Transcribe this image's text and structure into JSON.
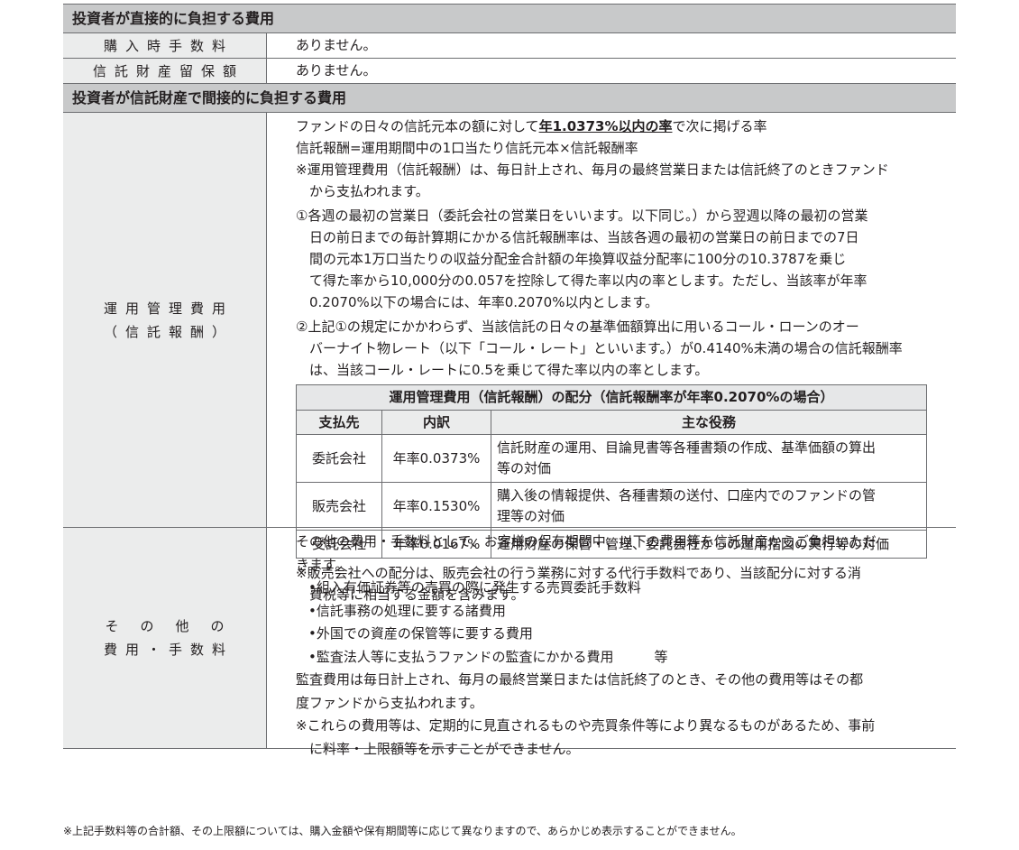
{
  "direct": {
    "header": "投資者が直接的に負担する費用",
    "rows": [
      {
        "label": "購入時手数料",
        "value": "ありません。"
      },
      {
        "label": "信託財産留保額",
        "value": "ありません。"
      }
    ]
  },
  "indirect": {
    "header": "投資者が信託財産で間接的に負担する費用",
    "mgmt": {
      "label_l1": "運用管理費用",
      "label_l2": "（信託報酬）",
      "p1_pre": "ファンドの日々の信託元本の額に対して",
      "p1_em": "年1.0373%以内の率",
      "p1_post": "で次に掲げる率",
      "p2": "信託報酬=運用期間中の1口当たり信託元本×信託報酬率",
      "n1_l1": "※運用管理費用（信託報酬）は、毎日計上され、毎月の最終営業日または信託終了のときファンド",
      "n1_l2": "から支払われます。",
      "c1_l1": "①各週の最初の営業日（委託会社の営業日をいいます。以下同じ。）から翌週以降の最初の営業",
      "c1_l2": "日の前日までの毎計算期にかかる信託報酬率は、当該各週の最初の営業日の前日までの7日",
      "c1_l3": "間の元本1万口当たりの収益分配金合計額の年換算収益分配率に100分の10.3787を乗じ",
      "c1_l4": "て得た率から10,000分の0.057を控除して得た率以内の率とします。ただし、当該率が年率",
      "c1_l5": "0.2070%以下の場合には、年率0.2070%以内とします。",
      "c2_l1": "②上記①の規定にかかわらず、当該信託の日々の基準価額算出に用いるコール・ローンのオー",
      "c2_l2": "バーナイト物レート（以下「コール・レート」といいます。）が0.4140%未満の場合の信託報酬率",
      "c2_l3": "は、当該コール・レートに0.5を乗じて得た率以内の率とします。",
      "table": {
        "title": "運用管理費用（信託報酬）の配分（信託報酬率が年率0.2070%の場合）",
        "headers": [
          "支払先",
          "内訳",
          "主な役務"
        ],
        "rows": [
          {
            "payee": "委託会社",
            "rate": "年率0.0373%",
            "role_l1": "信託財産の運用、目論見書等各種書類の作成、基準価額の算出",
            "role_l2": "等の対価"
          },
          {
            "payee": "販売会社",
            "rate": "年率0.1530%",
            "role_l1": "購入後の情報提供、各種書類の送付、口座内でのファンドの管",
            "role_l2": "理等の対価"
          },
          {
            "payee": "受託会社",
            "rate": "年率0.0167%",
            "role_l1": "運用財産の保管・管理、委託会社からの運用指図の実行等の対価",
            "role_l2": ""
          }
        ]
      },
      "n2_l1": "※販売会社への配分は、販売会社の行う業務に対する代行手数料であり、当該配分に対する消",
      "n2_l2": "費税等に相当する金額を含みます。"
    },
    "other": {
      "label_l1": "その他の",
      "label_l2": "費用・手数料",
      "p1_l1": "その他の費用・手数料として、お客様の保有期間中、以下の費用等を信託財産からご負担いただ",
      "p1_l2": "きます。",
      "bullets": [
        "•組入有価証券等の売買の際に発生する売買委託手数料",
        "•信託事務の処理に要する諸費用",
        "•外国での資産の保管等に要する費用",
        "•監査法人等に支払うファンドの監査にかかる費用　　　等"
      ],
      "p2_l1": "監査費用は毎日計上され、毎月の最終営業日または信託終了のとき、その他の費用等はその都",
      "p2_l2": "度ファンドから支払われます。",
      "n_l1": "※これらの費用等は、定期的に見直されるものや売買条件等により異なるものがあるため、事前",
      "n_l2": "に料率・上限額等を示すことができません。"
    }
  },
  "footnote": "※上記手数料等の合計額、その上限額については、購入金額や保有期間等に応じて異なりますので、あらかじめ表示することができません。"
}
